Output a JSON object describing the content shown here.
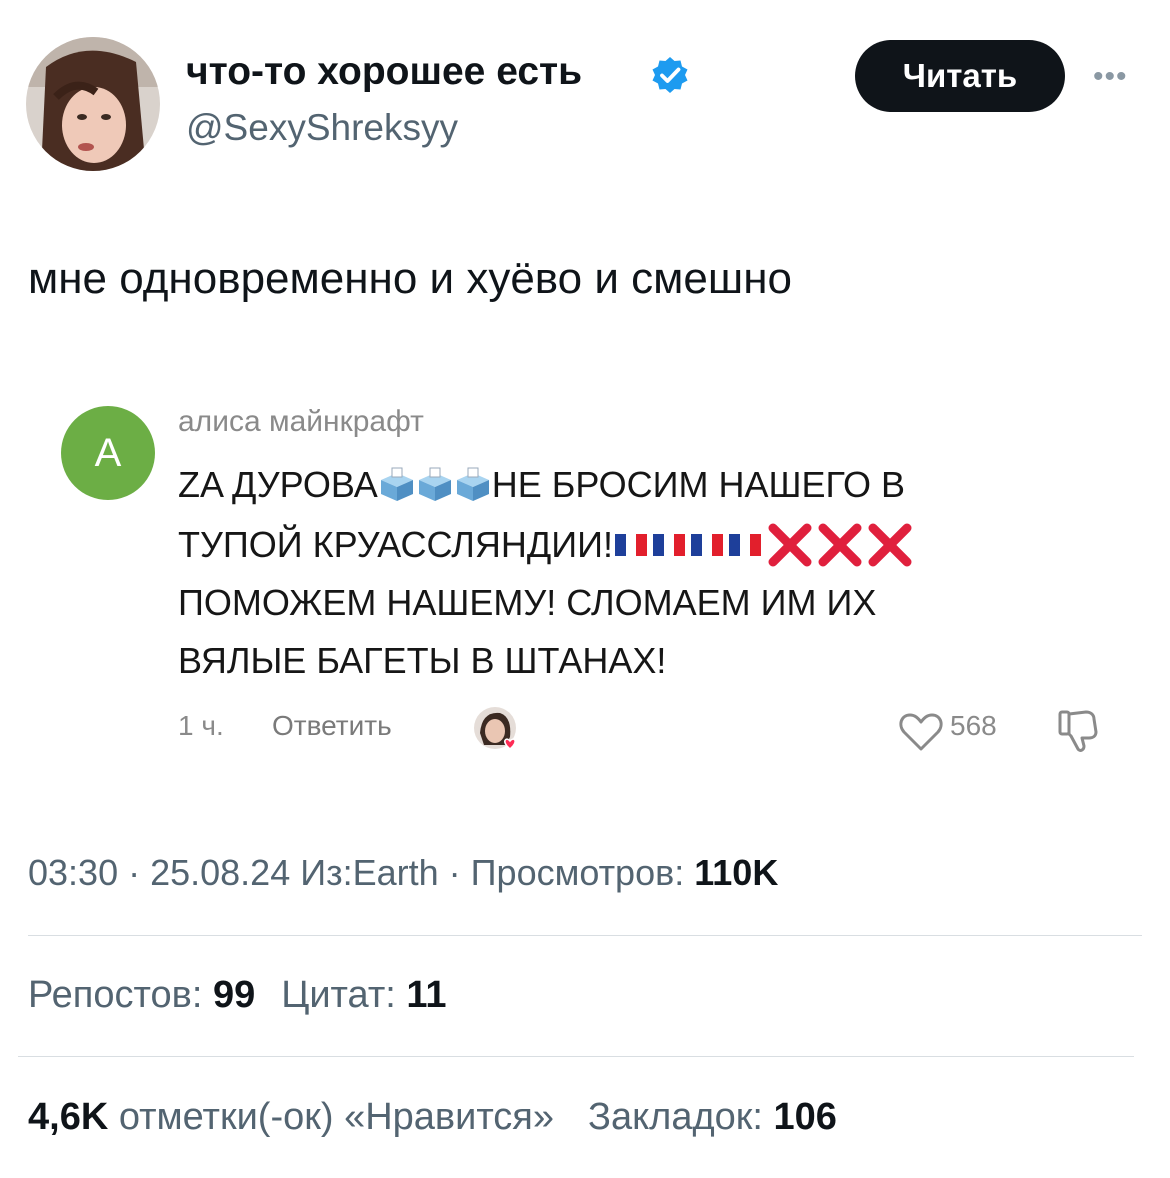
{
  "author": {
    "name": "что-то хорошее есть",
    "handle": "@SexyShreksyy",
    "verified": true,
    "verified_color": "#1d9bf0"
  },
  "actions": {
    "follow_label": "Читать",
    "more_label": "•••"
  },
  "tweet": {
    "text": "мне одновременно и хуёво и смешно"
  },
  "comment": {
    "avatar_letter": "А",
    "avatar_color": "#6cae45",
    "author": "алиса майнкрафт",
    "line1_a": "ZA ДУРОВА",
    "line1_b": "НЕ БРОСИМ НАШЕГО В",
    "line2_a": "ТУПОЙ КРУАССЛЯНДИИ!",
    "x_mark": "❌",
    "line3": "ПОМОЖЕМ НАШЕМУ! СЛОМАЕМ ИМ ИХ",
    "line4": "ВЯЛЫЕ БАГЕТЫ В ШТАНАХ!",
    "time": "1 ч.",
    "reply_label": "Ответить",
    "likes": "568",
    "icons": [
      "ballot-box-icon",
      "french-flag-icon",
      "cross-mark-icon",
      "heart-outline-icon",
      "thumbs-down-icon"
    ]
  },
  "meta": {
    "time": "03:30",
    "sep1": " · ",
    "date": "25.08.24",
    "source": " Из:Earth",
    "sep2": " · ",
    "views_label": "Просмотров: ",
    "views": "110K"
  },
  "stats1": {
    "reposts_label": "Репостов: ",
    "reposts": "99",
    "quotes_label": "Цитат: ",
    "quotes": "11"
  },
  "stats2": {
    "likes": "4,6K",
    "likes_label": " отметки(-ок) «Нравится»",
    "bookmarks_label": "Закладок: ",
    "bookmarks": "106"
  }
}
